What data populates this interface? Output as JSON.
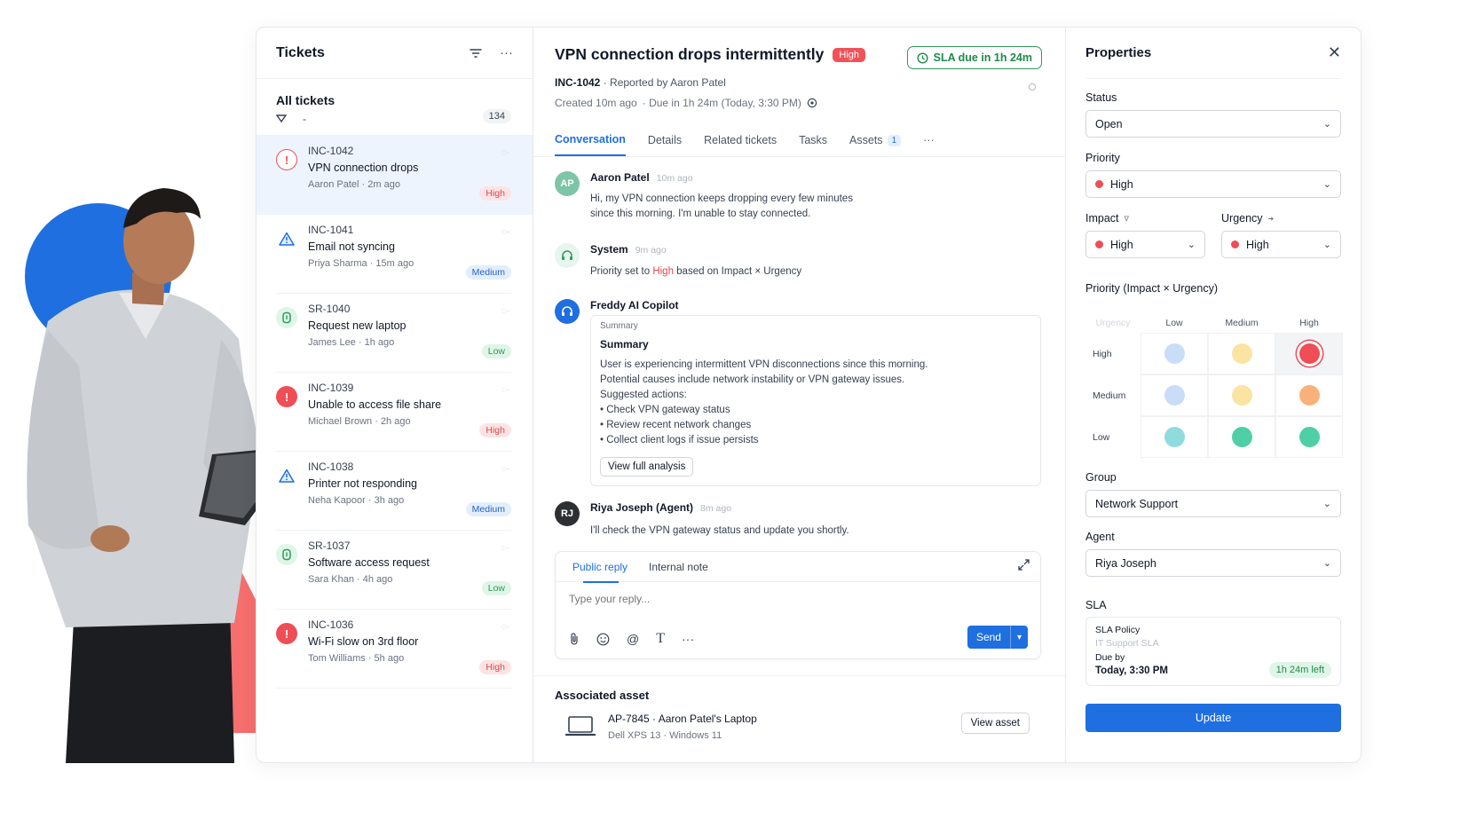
{
  "list": {
    "title": "Tickets",
    "view_label": "All tickets",
    "count": "134",
    "tickets": [
      {
        "id": "INC-1042",
        "subject": "VPN connection drops",
        "meta": "Aaron Patel · 2m ago",
        "priority": "High",
        "icon": "!",
        "icon_name": "alert-circle-icon"
      },
      {
        "id": "INC-1041",
        "subject": "Email not syncing",
        "meta": "Priya Sharma · 15m ago",
        "priority": "Medium",
        "icon": "!",
        "icon_name": "warning-triangle-icon"
      },
      {
        "id": "SR-1040",
        "subject": "Request new laptop",
        "meta": "James Lee · 1h ago",
        "priority": "Low",
        "icon": "⧖",
        "icon_name": "service-request-icon"
      },
      {
        "id": "INC-1039",
        "subject": "Unable to access file share",
        "meta": "Michael Brown · 2h ago",
        "priority": "High",
        "icon": "!",
        "icon_name": "alert-circle-icon"
      },
      {
        "id": "INC-1038",
        "subject": "Printer not responding",
        "meta": "Neha Kapoor · 3h ago",
        "priority": "Medium",
        "icon": "!",
        "icon_name": "warning-triangle-icon"
      },
      {
        "id": "SR-1037",
        "subject": "Software access request",
        "meta": "Sara Khan · 4h ago",
        "priority": "Low",
        "icon": "⧖",
        "icon_name": "service-request-icon"
      },
      {
        "id": "INC-1036",
        "subject": "Wi-Fi slow on 3rd floor",
        "meta": "Tom Williams · 5h ago",
        "priority": "High",
        "icon": "!",
        "icon_name": "alert-circle-icon"
      }
    ]
  },
  "conversation": {
    "title": "VPN connection drops intermittently",
    "priority_pill": "High",
    "sla_chip": "SLA due in 1h 24m",
    "ticket_id": "INC-1042",
    "reported_by": "· Reported by Aaron Patel",
    "created": "Created 10m ago",
    "due": "· Due in 1h 24m (Today, 3:30 PM)",
    "tabs": [
      "Conversation",
      "Details",
      "Related tickets",
      "Tasks",
      "Assets"
    ],
    "assets_count": "1",
    "messages": {
      "customer": {
        "initials": "AP",
        "name": "Aaron Patel",
        "time": "10m ago",
        "text1": "Hi, my VPN connection keeps dropping every few minutes",
        "text2": "since this morning. I'm unable to stay connected."
      },
      "system": {
        "name": "System",
        "time": "9m ago",
        "text_a": "Priority set to ",
        "text_b": "High",
        "text_c": " based on Impact × Urgency"
      },
      "ai": {
        "name": "Freddy AI Copilot",
        "tag": "Summary",
        "heading": "Summary",
        "lines": [
          "User is experiencing intermittent VPN disconnections since this morning.",
          "Potential causes include network instability or VPN gateway issues.",
          "Suggested actions:",
          "• Check VPN gateway status",
          "• Review recent network changes",
          "• Collect client logs if issue persists"
        ],
        "button": "View full analysis"
      },
      "agent": {
        "initials": "RJ",
        "name": "Riya Joseph (Agent)",
        "time": "8m ago",
        "text": "I'll check the VPN gateway status and update you shortly."
      }
    },
    "reply": {
      "tab_public": "Public reply",
      "tab_internal": "Internal note",
      "placeholder": "Type your reply...",
      "send": "Send"
    },
    "asset": {
      "section_title": "Associated asset",
      "name": "AP-7845 · Aaron Patel's Laptop",
      "sub": "Dell XPS 13 · Windows 11",
      "button": "View asset"
    }
  },
  "properties": {
    "title": "Properties",
    "status_label": "Status",
    "status_value": "Open",
    "priority_label": "Priority",
    "priority_value": "High",
    "impact_label": "Impact",
    "impact_value": "High",
    "urgency_label": "Urgency",
    "urgency_value": "High",
    "matrix_label": "Priority (Impact × Urgency)",
    "matrix": {
      "corner": "Urgency",
      "cols": [
        "Low",
        "Medium",
        "High"
      ],
      "rows": [
        "High",
        "Medium",
        "Low"
      ],
      "colors": [
        [
          "#c9ddf7",
          "#fbe3a1",
          "#ef4e56"
        ],
        [
          "#c9ddf7",
          "#fbe3a1",
          "#f9b07a"
        ],
        [
          "#8fdcdf",
          "#4fcfa5",
          "#4fcfa5"
        ]
      ],
      "selected": "High/High"
    },
    "group_label": "Group",
    "group_value": "Network Support",
    "agent_label": "Agent",
    "agent_value": "Riya Joseph",
    "sla_label": "SLA",
    "sla_policy_key": "SLA Policy",
    "sla_policy_value": "IT Support SLA",
    "sla_due_key": "Due by",
    "sla_due_value": "Today, 3:30 PM",
    "sla_left": "1h 24m left",
    "update": "Update"
  },
  "colors": {
    "accent": "#1f6fe0",
    "high": "#ef4e56",
    "green": "#2f9a5a"
  }
}
